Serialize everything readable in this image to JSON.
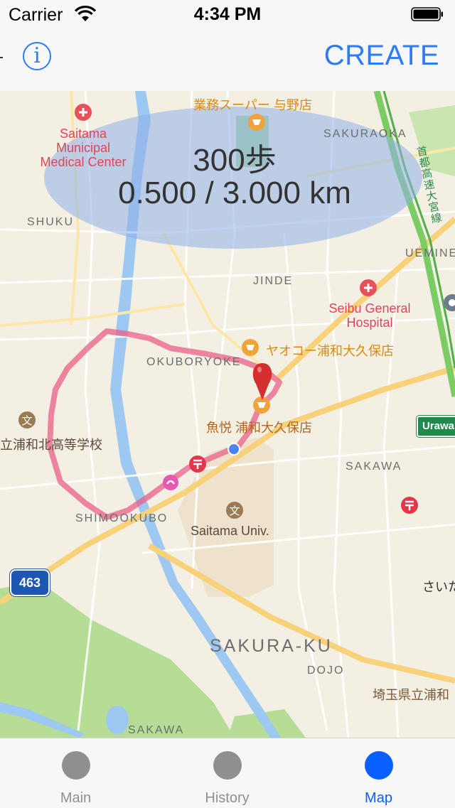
{
  "status_bar": {
    "carrier": "Carrier",
    "time": "4:34 PM",
    "wifi_icon": "wifi-icon",
    "battery_icon": "battery-icon"
  },
  "nav_bar": {
    "info_label": "i",
    "create_label": "CREATE",
    "accent_color": "#2f7af5"
  },
  "map": {
    "overlay": {
      "steps_text": "300歩",
      "distance_text": "0.500 / 3.000 km"
    },
    "labels": {
      "supermarket": "業務スーパー 与野店",
      "sakuraoka": "SAKURAOKA",
      "hospital_saitama": [
        "Saitama",
        "Municipal",
        "Medical Center"
      ],
      "shuku": "SHUKU",
      "expressway": "首都高速大宮線",
      "uemine": "UEMINE",
      "jinde": "JINDE",
      "seibu_hospital": [
        "Seibu General",
        "Hospital"
      ],
      "yaoko": "ヤオコー浦和大久保店",
      "okuboryoke": "OKUBORYOKE",
      "uoetsu": "魚悦 浦和大久保店",
      "high_school": "立浦和北高等学校",
      "urawa_sign": "Urawa",
      "sakawa_east": "SAKAWA",
      "shimookubo": "SHIMOOKUBO",
      "university": "Saitama Univ.",
      "route_463": "463",
      "saita": "さいた",
      "sakura_ku": "SAKURA-KU",
      "dojo": "DOJO",
      "saitama_pref": "埼玉県立浦和",
      "sakawa_south": "SAKAWA"
    },
    "colors": {
      "route": "#e9608a",
      "overlay_fill": "#8fb0ea",
      "river": "#9cc8f2",
      "park": "#b5dd95",
      "pin": "#d32f2f"
    }
  },
  "tab_bar": {
    "tabs": [
      {
        "label": "Main",
        "icon": "circle-icon",
        "active": false
      },
      {
        "label": "History",
        "icon": "circle-icon",
        "active": false
      },
      {
        "label": "Map",
        "icon": "circle-icon",
        "active": true
      }
    ],
    "active_color": "#0a60fe",
    "inactive_color": "#8f8f8f"
  }
}
